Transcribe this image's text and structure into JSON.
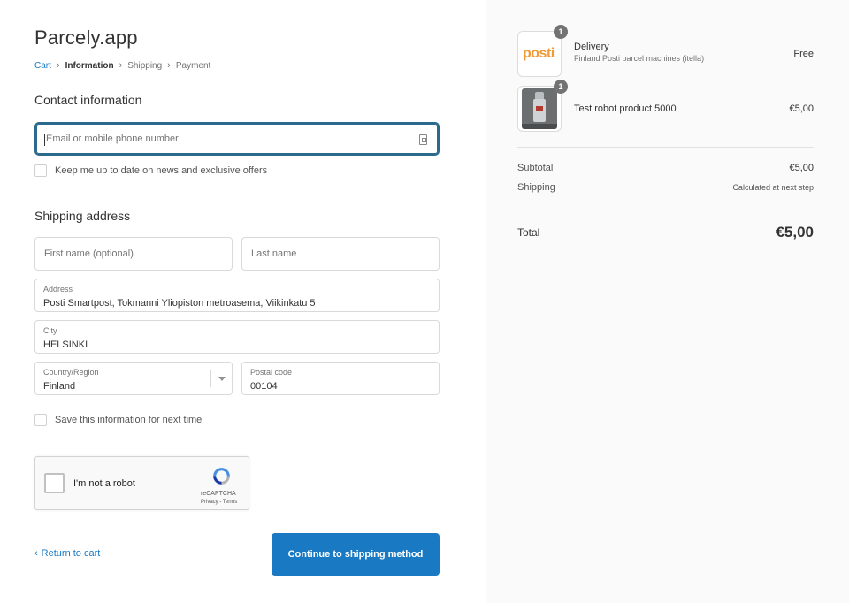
{
  "header": {
    "store_name": "Parcely.app"
  },
  "breadcrumb": {
    "cart": "Cart",
    "information": "Information",
    "shipping": "Shipping",
    "payment": "Payment"
  },
  "contact": {
    "title": "Contact information",
    "email_placeholder": "Email or mobile phone number",
    "newsletter_label": "Keep me up to date on news and exclusive offers"
  },
  "shipping": {
    "title": "Shipping address",
    "first_name_placeholder": "First name (optional)",
    "last_name_placeholder": "Last name",
    "address_label": "Address",
    "address_value": "Posti Smartpost, Tokmanni Yliopiston metroasema, Viikinkatu 5",
    "city_label": "City",
    "city_value": "HELSINKI",
    "country_label": "Country/Region",
    "country_value": "Finland",
    "postal_label": "Postal code",
    "postal_value": "00104",
    "save_label": "Save this information for next time"
  },
  "captcha": {
    "label": "I'm not a robot",
    "brand": "reCAPTCHA",
    "terms": "Privacy - Terms"
  },
  "actions": {
    "return_label": "Return to cart",
    "continue_label": "Continue to shipping method"
  },
  "order": {
    "items": [
      {
        "name": "Delivery",
        "subtitle": "Finland Posti parcel machines (itella)",
        "price": "Free",
        "quantity": "1",
        "logo_text": "posti"
      },
      {
        "name": "Test robot product 5000",
        "subtitle": "",
        "price": "€5,00",
        "quantity": "1"
      }
    ],
    "subtotal_label": "Subtotal",
    "subtotal_value": "€5,00",
    "shipping_label": "Shipping",
    "shipping_value": "Calculated at next step",
    "total_label": "Total",
    "total_value": "€5,00"
  },
  "colors": {
    "accent": "#1979c3",
    "posti_orange": "#f09a37",
    "focus_border": "#2b6a8c"
  }
}
